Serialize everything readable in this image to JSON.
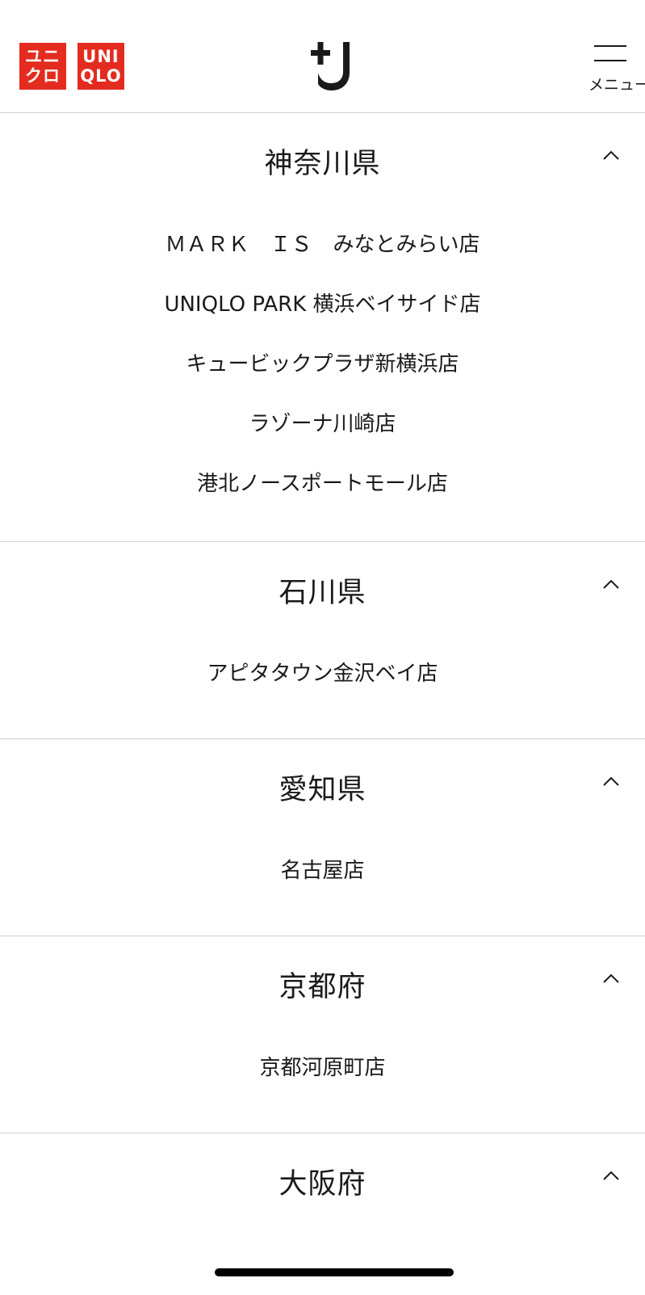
{
  "header": {
    "logo_jp_line1": "ユニ",
    "logo_jp_line2": "クロ",
    "logo_en_line1": "UNI",
    "logo_en_line2": "QLO",
    "brand_mark": "+J",
    "menu_label": "メニュー",
    "accent_color": "#e32c1f"
  },
  "sections": [
    {
      "title": "神奈川県",
      "stores": [
        "ＭＡＲＫ　ＩＳ　みなとみらい店",
        "UNIQLO PARK 横浜ベイサイド店",
        "キュービックプラザ新横浜店",
        "ラゾーナ川崎店",
        "港北ノースポートモール店"
      ]
    },
    {
      "title": "石川県",
      "stores": [
        "アピタタウン金沢ベイ店"
      ]
    },
    {
      "title": "愛知県",
      "stores": [
        "名古屋店"
      ]
    },
    {
      "title": "京都府",
      "stores": [
        "京都河原町店"
      ]
    },
    {
      "title": "大阪府",
      "stores": []
    }
  ],
  "icons": {
    "section_toggle": "chevron-up-icon",
    "menu": "hamburger-icon"
  }
}
